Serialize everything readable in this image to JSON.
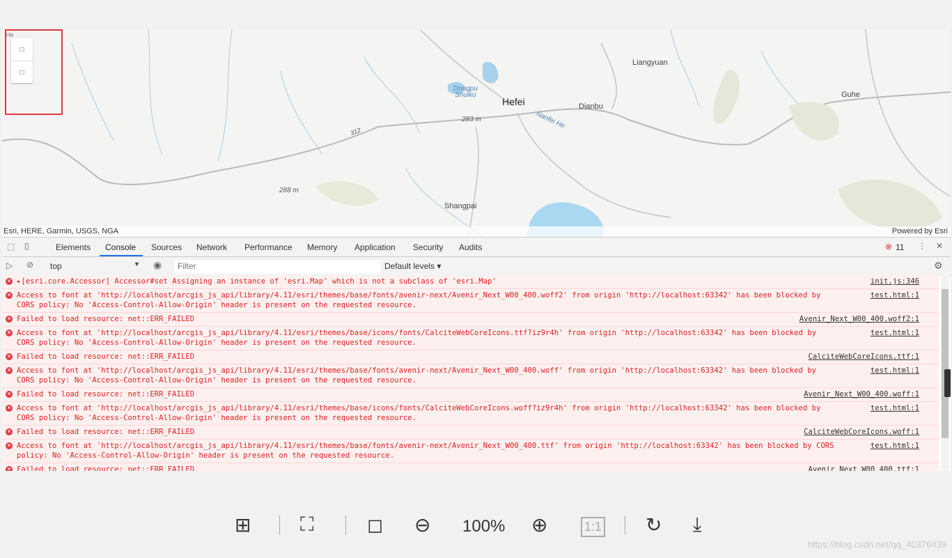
{
  "map": {
    "labels": {
      "city1": "Hefei",
      "city2": "Liangyuan",
      "city3": "Dianbu",
      "city4": "Guhe",
      "city5": "Shangpai",
      "water1": "Dongpu",
      "water2": "Shuiku",
      "river": "Nanfei He",
      "elev1": "283 m",
      "elev2": "288 m",
      "road": "312",
      "edge": "He"
    },
    "zoom_in": "□",
    "zoom_out": "□",
    "attribution": "Esri, HERE, Garmin, USGS, NGA",
    "powered_by": "Powered by Esri"
  },
  "devtools": {
    "tabs": [
      "Elements",
      "Console",
      "Sources",
      "Network",
      "Performance",
      "Memory",
      "Application",
      "Security",
      "Audits"
    ],
    "error_count": "11",
    "context": "top",
    "filter_placeholder": "Filter",
    "levels": "Default levels ▾",
    "messages": [
      {
        "text": "▸[esri.core.Accessor] Accessor#set Assigning an instance of 'esri.Map' which is not a subclass of 'esri.Map'",
        "src": "init.js:346"
      },
      {
        "text": "Access to font at 'http://localhost/arcgis_js_api/library/4.11/esri/themes/base/fonts/avenir-next/Avenir_Next_W00_400.woff2' from origin 'http://localhost:63342' has been blocked by\nCORS policy: No 'Access-Control-Allow-Origin' header is present on the requested resource.",
        "src": "test.html:1"
      },
      {
        "text": "Failed to load resource: net::ERR_FAILED",
        "src": "Avenir_Next_W00_400.woff2:1"
      },
      {
        "text": "Access to font at 'http://localhost/arcgis_js_api/library/4.11/esri/themes/base/icons/fonts/CalciteWebCoreIcons.ttf?iz9r4h' from origin 'http://localhost:63342' has been blocked by\nCORS policy: No 'Access-Control-Allow-Origin' header is present on the requested resource.",
        "src": "test.html:1"
      },
      {
        "text": "Failed to load resource: net::ERR_FAILED",
        "src": "CalciteWebCoreIcons.ttf:1"
      },
      {
        "text": "Access to font at 'http://localhost/arcgis_js_api/library/4.11/esri/themes/base/fonts/avenir-next/Avenir_Next_W00_400.woff' from origin 'http://localhost:63342' has been blocked by\nCORS policy: No 'Access-Control-Allow-Origin' header is present on the requested resource.",
        "src": "test.html:1"
      },
      {
        "text": "Failed to load resource: net::ERR_FAILED",
        "src": "Avenir_Next_W00_400.woff:1"
      },
      {
        "text": "Access to font at 'http://localhost/arcgis_js_api/library/4.11/esri/themes/base/icons/fonts/CalciteWebCoreIcons.woff?iz9r4h' from origin 'http://localhost:63342' has been blocked by\nCORS policy: No 'Access-Control-Allow-Origin' header is present on the requested resource.",
        "src": "test.html:1"
      },
      {
        "text": "Failed to load resource: net::ERR_FAILED",
        "src": "CalciteWebCoreIcons.woff:1"
      },
      {
        "text": "Access to font at 'http://localhost/arcgis_js_api/library/4.11/esri/themes/base/fonts/avenir-next/Avenir_Next_W00_400.ttf' from origin 'http://localhost:63342' has been blocked by CORS\npolicy: No 'Access-Control-Allow-Origin' header is present on the requested resource.",
        "src": "test.html:1"
      },
      {
        "text": "Failed to load resource: net::ERR_FAILED",
        "src": "Avenir_Next_W00_400.ttf:1"
      }
    ]
  },
  "viewer": {
    "zoom_level": "100%",
    "ratio": "1:1",
    "watermark": "https://blog.csdn.net/qq_40376439"
  }
}
